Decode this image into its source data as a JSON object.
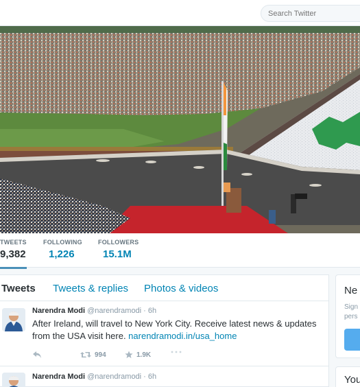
{
  "search": {
    "placeholder": "Search Twitter"
  },
  "stats": [
    {
      "label": "TWEETS",
      "value": "9,382"
    },
    {
      "label": "FOLLOWING",
      "value": "1,226"
    },
    {
      "label": "FOLLOWERS",
      "value": "15.1M"
    }
  ],
  "tabs": [
    {
      "label": "Tweets"
    },
    {
      "label": "Tweets & replies"
    },
    {
      "label": "Photos & videos"
    }
  ],
  "tweets": [
    {
      "name": "Narendra Modi",
      "meta": "@narendramodi · 6h",
      "text": "After Ireland, will travel to New York City. Receive latest news & updates from the USA visit here. ",
      "link": "narendramodi.in/usa_home",
      "retweets": "994",
      "likes": "1.9K"
    },
    {
      "name": "Narendra Modi",
      "meta": "@narendramodi · 6h"
    }
  ],
  "sidebar": {
    "new_title": "Ne",
    "new_sub1": "Sign",
    "new_sub2": "pers",
    "you_title": "You"
  },
  "colors": {
    "link": "#0084b4",
    "accent": "#55acee"
  }
}
